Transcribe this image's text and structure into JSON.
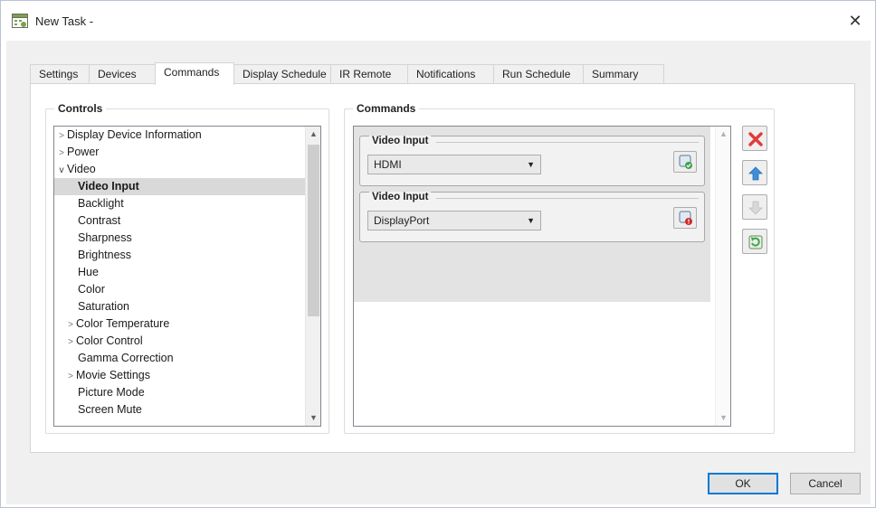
{
  "window": {
    "title": "New Task -"
  },
  "tabs": [
    {
      "label": "Settings"
    },
    {
      "label": "Devices"
    },
    {
      "label": "Commands"
    },
    {
      "label": "Display Schedule"
    },
    {
      "label": "IR Remote"
    },
    {
      "label": "Notifications"
    },
    {
      "label": "Run Schedule"
    },
    {
      "label": "Summary"
    }
  ],
  "active_tab": "Commands",
  "controls": {
    "title": "Controls",
    "items": [
      {
        "label": "Display Device Information",
        "expander": "collapsed"
      },
      {
        "label": "Power",
        "expander": "collapsed"
      },
      {
        "label": "Video",
        "expander": "expanded"
      },
      {
        "label": "Video Input",
        "selected": true
      },
      {
        "label": "Backlight"
      },
      {
        "label": "Contrast"
      },
      {
        "label": "Sharpness"
      },
      {
        "label": "Brightness"
      },
      {
        "label": "Hue"
      },
      {
        "label": "Color"
      },
      {
        "label": "Saturation"
      },
      {
        "label": "Color Temperature",
        "expander": "collapsed"
      },
      {
        "label": "Color Control",
        "expander": "collapsed"
      },
      {
        "label": "Gamma Correction"
      },
      {
        "label": "Movie Settings",
        "expander": "collapsed"
      },
      {
        "label": "Picture Mode"
      },
      {
        "label": "Screen Mute"
      }
    ]
  },
  "commands": {
    "title": "Commands",
    "items": [
      {
        "label": "Video Input",
        "value": "HDMI",
        "action_icon": "execute-ok-icon"
      },
      {
        "label": "Video Input",
        "value": "DisplayPort",
        "action_icon": "execute-error-icon"
      }
    ]
  },
  "side_buttons": [
    {
      "icon": "delete-icon"
    },
    {
      "icon": "move-up-icon"
    },
    {
      "icon": "move-down-icon"
    },
    {
      "icon": "refresh-icon"
    }
  ],
  "footer": {
    "ok": "OK",
    "cancel": "Cancel"
  },
  "colors": {
    "accent": "#0078d7",
    "selection": "#d9d9d9",
    "delete_red": "#e23a3a",
    "up_blue": "#3d8fdc"
  }
}
